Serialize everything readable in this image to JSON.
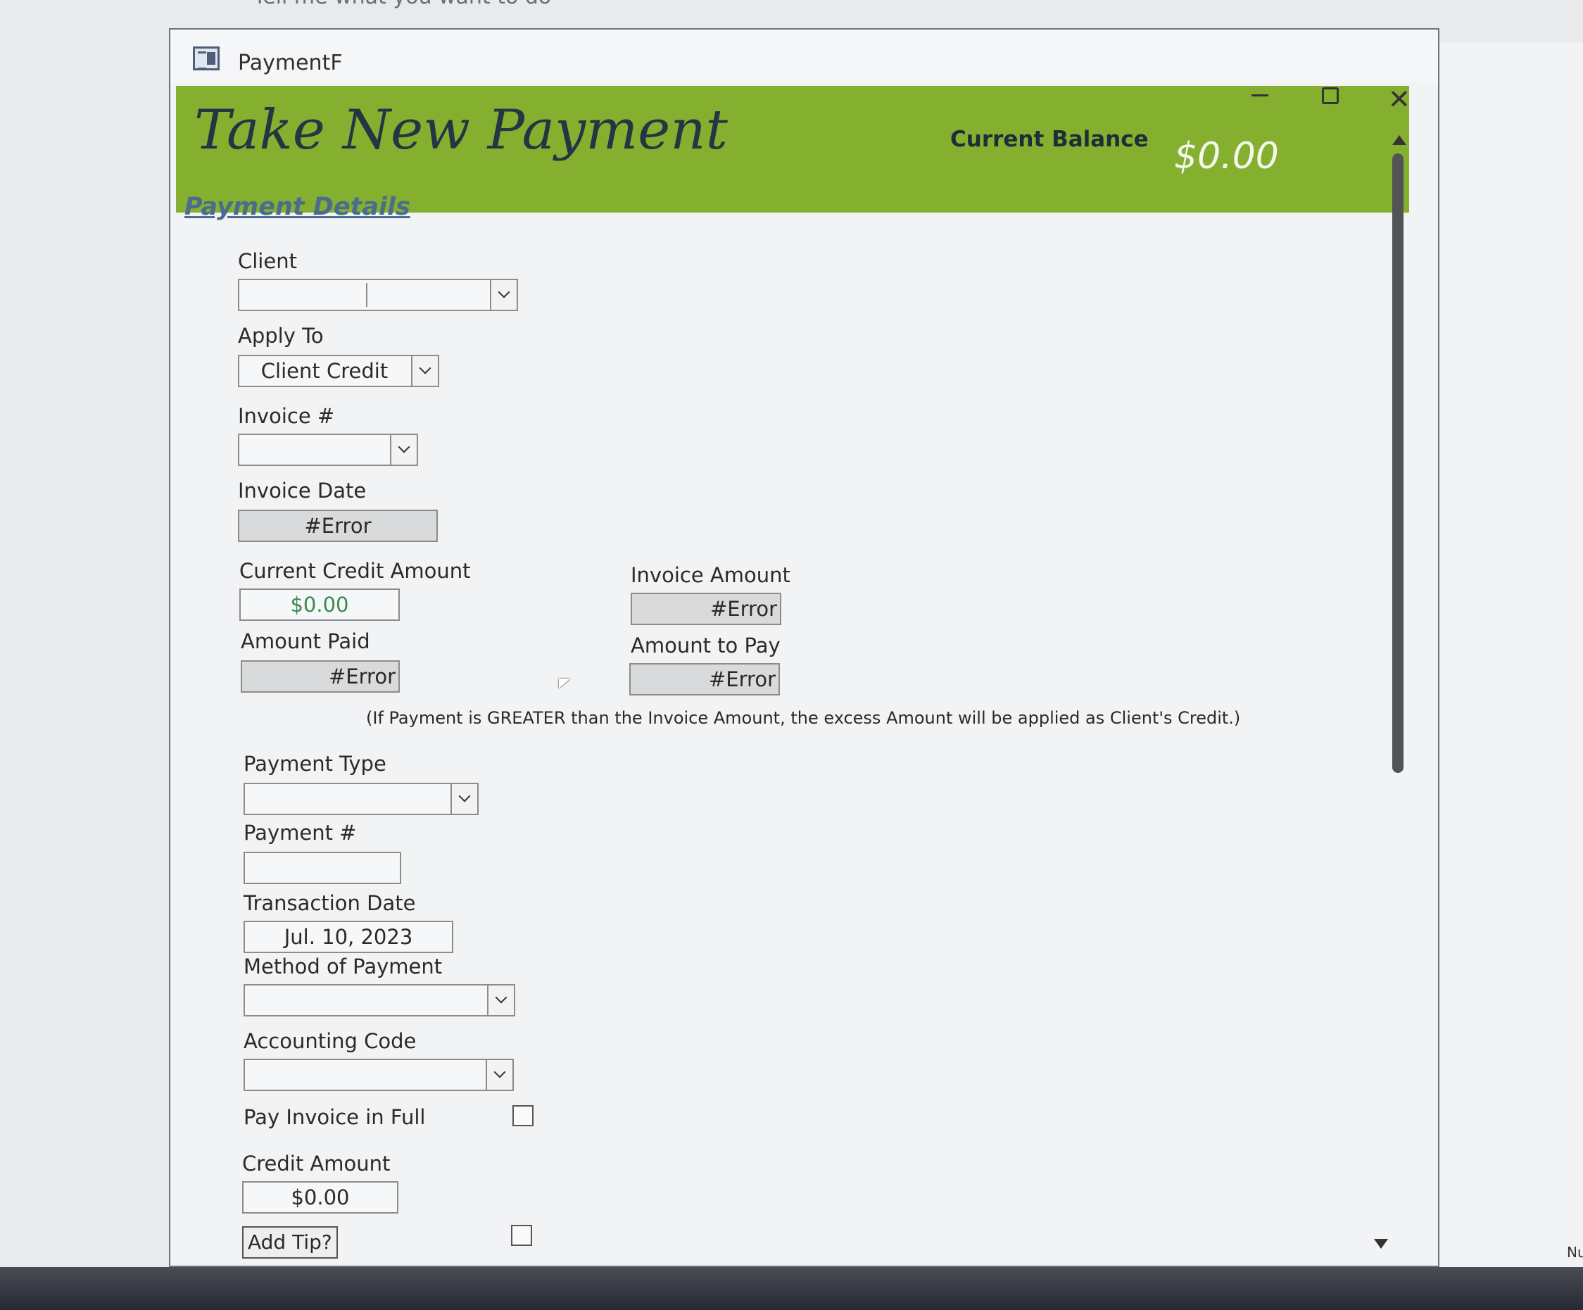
{
  "background": {
    "hint_text": "Tell me what you want to do",
    "right_edge_text": "Nu"
  },
  "window": {
    "title": "PaymentF",
    "icon": "form-icon",
    "controls": {
      "minimize": "minimize-icon",
      "maximize": "maximize-icon",
      "close": "close-icon"
    }
  },
  "header": {
    "title": "Take New Payment",
    "balance_label": "Current Balance",
    "balance_value": "$0.00",
    "color": "#85b02f"
  },
  "section": {
    "title": "Payment Details"
  },
  "fields": {
    "client": {
      "label": "Client",
      "value": ""
    },
    "apply_to": {
      "label": "Apply To",
      "value": "Client Credit"
    },
    "invoice_no": {
      "label": "Invoice #",
      "value": ""
    },
    "invoice_date": {
      "label": "Invoice Date",
      "value": "#Error"
    },
    "current_credit": {
      "label": "Current Credit Amount",
      "value": "$0.00"
    },
    "invoice_amount": {
      "label": "Invoice Amount",
      "value": "#Error"
    },
    "amount_paid": {
      "label": "Amount Paid",
      "value": "#Error"
    },
    "amount_to_pay": {
      "label": "Amount to Pay",
      "value": "#Error"
    },
    "payment_type": {
      "label": "Payment Type",
      "value": ""
    },
    "payment_no": {
      "label": "Payment #",
      "value": ""
    },
    "transaction_date": {
      "label": "Transaction Date",
      "value": "Jul. 10, 2023"
    },
    "method_of_payment": {
      "label": "Method of Payment",
      "value": ""
    },
    "accounting_code": {
      "label": "Accounting Code",
      "value": ""
    },
    "pay_in_full": {
      "label": "Pay Invoice in Full",
      "checked": false
    },
    "credit_amount": {
      "label": "Credit Amount",
      "value": "$0.00"
    },
    "add_tip": {
      "label": "Add Tip?",
      "checked": false
    }
  },
  "note": "(If Payment is GREATER than the Invoice Amount, the excess Amount will be applied as Client's Credit.)"
}
